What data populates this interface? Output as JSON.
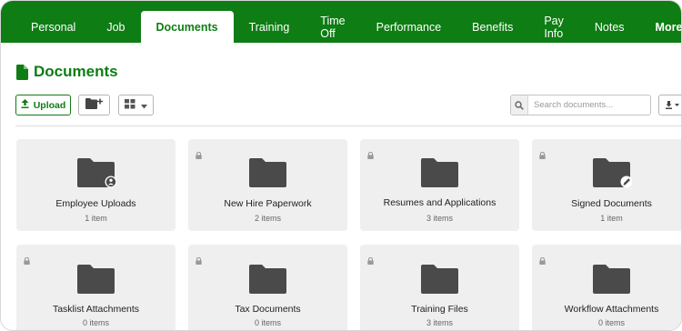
{
  "tabs": [
    {
      "label": "Personal",
      "active": false
    },
    {
      "label": "Job",
      "active": false
    },
    {
      "label": "Documents",
      "active": true
    },
    {
      "label": "Training",
      "active": false
    },
    {
      "label": "Time Off",
      "active": false
    },
    {
      "label": "Performance",
      "active": false
    },
    {
      "label": "Benefits",
      "active": false
    },
    {
      "label": "Pay Info",
      "active": false
    },
    {
      "label": "Notes",
      "active": false
    }
  ],
  "more_label": "More",
  "page_title": "Documents",
  "toolbar": {
    "upload_label": "Upload",
    "search_placeholder": "Search documents..."
  },
  "colors": {
    "brand_green": "#0e7d14",
    "card_bg": "#efefef",
    "folder": "#4a4a4a"
  },
  "folders": [
    {
      "name": "Employee Uploads",
      "count": "1 item",
      "locked": false,
      "badge": "person-icon"
    },
    {
      "name": "New Hire Paperwork",
      "count": "2 items",
      "locked": true,
      "badge": ""
    },
    {
      "name": "Resumes and Applications",
      "count": "3 items",
      "locked": true,
      "badge": ""
    },
    {
      "name": "Signed Documents",
      "count": "1 item",
      "locked": true,
      "badge": "pen-icon"
    },
    {
      "name": "Tasklist Attachments",
      "count": "0 items",
      "locked": true,
      "badge": ""
    },
    {
      "name": "Tax Documents",
      "count": "0 items",
      "locked": true,
      "badge": ""
    },
    {
      "name": "Training Files",
      "count": "3 items",
      "locked": true,
      "badge": ""
    },
    {
      "name": "Workflow Attachments",
      "count": "0 items",
      "locked": true,
      "badge": ""
    }
  ]
}
